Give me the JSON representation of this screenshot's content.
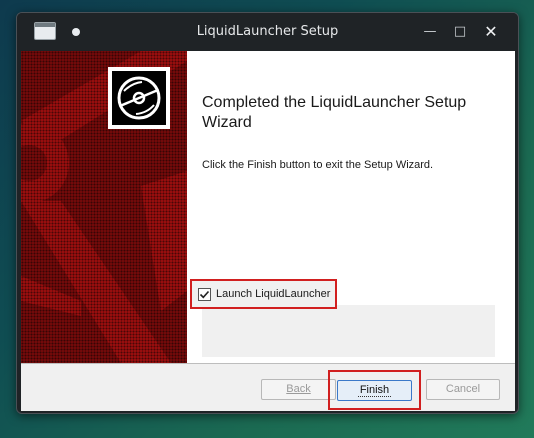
{
  "window": {
    "title": "LiquidLauncher Setup",
    "controls": {
      "minimize": "—",
      "maximize": "□",
      "close": "✕"
    }
  },
  "banner": {
    "logo_icon": "disc-icon",
    "colors": {
      "background": "#7a0b0b",
      "shape": "#a10f0f"
    }
  },
  "main": {
    "heading": "Completed the LiquidLauncher Setup Wizard",
    "description": "Click the Finish button to exit the Setup Wizard.",
    "launch_option": {
      "label": "Launch LiquidLauncher",
      "checked": true
    }
  },
  "footer": {
    "back": {
      "label": "Back",
      "enabled": false
    },
    "finish": {
      "label": "Finish",
      "enabled": true
    },
    "cancel": {
      "label": "Cancel",
      "enabled": false
    }
  },
  "highlight_color": "#d11f1f"
}
